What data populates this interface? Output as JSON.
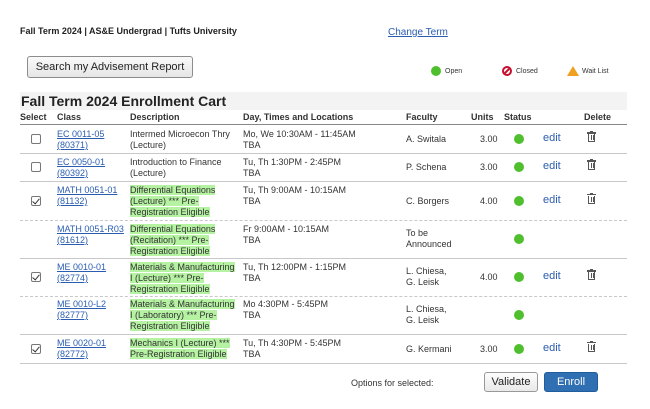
{
  "header": {
    "term_line": "Fall Term 2024 | AS&E Undergrad | Tufts University",
    "change_term": "Change Term",
    "search_button": "Search my Advisement Report"
  },
  "legend": {
    "open": "Open",
    "closed": "Closed",
    "wait_list": "Wait List"
  },
  "cart": {
    "title": "Fall Term 2024 Enrollment Cart",
    "columns": {
      "select": "Select",
      "class": "Class",
      "description": "Description",
      "days_times_locations": "Day, Times and Locations",
      "faculty": "Faculty",
      "units": "Units",
      "status": "Status",
      "delete": "Delete"
    },
    "rows": [
      {
        "checked": false,
        "has_checkbox": true,
        "class_line1": "EC 0011-05",
        "class_line2": "(80371)",
        "desc_line1": "Intermed Microecon Thry",
        "desc_line2": "(Lecture)",
        "desc_line3": "",
        "highlight": false,
        "time_line1": "Mo, We 10:30AM - 11:45AM",
        "time_line2": "TBA",
        "faculty_line1": "A. Switala",
        "faculty_line2": "",
        "units": "3.00",
        "status": "Open",
        "edit": "edit",
        "deletable": true
      },
      {
        "checked": false,
        "has_checkbox": true,
        "class_line1": "EC 0050-01",
        "class_line2": "(80392)",
        "desc_line1": "Introduction to Finance",
        "desc_line2": "(Lecture)",
        "desc_line3": "",
        "highlight": false,
        "time_line1": "Tu, Th 1:30PM - 2:45PM",
        "time_line2": "TBA",
        "faculty_line1": "P. Schena",
        "faculty_line2": "",
        "units": "3.00",
        "status": "Open",
        "edit": "edit",
        "deletable": true
      },
      {
        "checked": true,
        "has_checkbox": true,
        "class_line1": "MATH 0051-01",
        "class_line2": "(81132)",
        "desc_line1": "Differential Equations",
        "desc_line2": "(Lecture) *** Pre-",
        "desc_line3": "Registration Eligible",
        "highlight": true,
        "time_line1": "Tu, Th 9:00AM - 10:15AM",
        "time_line2": "TBA",
        "faculty_line1": "C. Borgers",
        "faculty_line2": "",
        "units": "4.00",
        "status": "Open",
        "edit": "edit",
        "deletable": true
      },
      {
        "checked": false,
        "has_checkbox": false,
        "class_line1": "MATH 0051-R03",
        "class_line2": "(81612)",
        "desc_line1": "Differential Equations",
        "desc_line2": "(Recitation) *** Pre-",
        "desc_line3": "Registration Eligible",
        "highlight": true,
        "time_line1": "Fr 9:00AM - 10:15AM",
        "time_line2": "TBA",
        "faculty_line1": "To be",
        "faculty_line2": "Announced",
        "units": "",
        "status": "Open",
        "edit": "",
        "deletable": false
      },
      {
        "checked": true,
        "has_checkbox": true,
        "class_line1": "ME 0010-01",
        "class_line2": "(82774)",
        "desc_line1": "Materials & Manufacturing",
        "desc_line2": "I (Lecture) *** Pre-",
        "desc_line3": "Registration Eligible",
        "highlight": true,
        "time_line1": "Tu, Th 12:00PM - 1:15PM",
        "time_line2": "TBA",
        "faculty_line1": "L. Chiesa,",
        "faculty_line2": "G. Leisk",
        "units": "4.00",
        "status": "Open",
        "edit": "edit",
        "deletable": true
      },
      {
        "checked": false,
        "has_checkbox": false,
        "class_line1": "ME 0010-L2",
        "class_line2": "(82777)",
        "desc_line1": "Materials & Manufacturing",
        "desc_line2": "I (Laboratory) *** Pre-",
        "desc_line3": "Registration Eligible",
        "highlight": true,
        "time_line1": "Mo 4:30PM - 5:45PM",
        "time_line2": "TBA",
        "faculty_line1": "L. Chiesa,",
        "faculty_line2": "G. Leisk",
        "units": "",
        "status": "Open",
        "edit": "",
        "deletable": false
      },
      {
        "checked": true,
        "has_checkbox": true,
        "class_line1": "ME 0020-01",
        "class_line2": "(82772)",
        "desc_line1": "Mechanics I (Lecture) ***",
        "desc_line2": "Pre-Registration Eligible",
        "desc_line3": "",
        "highlight": true,
        "time_line1": "Tu, Th 4:30PM - 5:45PM",
        "time_line2": "TBA",
        "faculty_line1": "G. Kermani",
        "faculty_line2": "",
        "units": "3.00",
        "status": "Open",
        "edit": "edit",
        "deletable": true
      }
    ]
  },
  "footer": {
    "options_label": "Options for selected:",
    "validate": "Validate",
    "enroll": "Enroll"
  },
  "colors": {
    "link": "#2a5db0",
    "open_status": "#4fbf2e",
    "highlight": "#b5f2a2",
    "enroll_button": "#2f6fb2"
  }
}
